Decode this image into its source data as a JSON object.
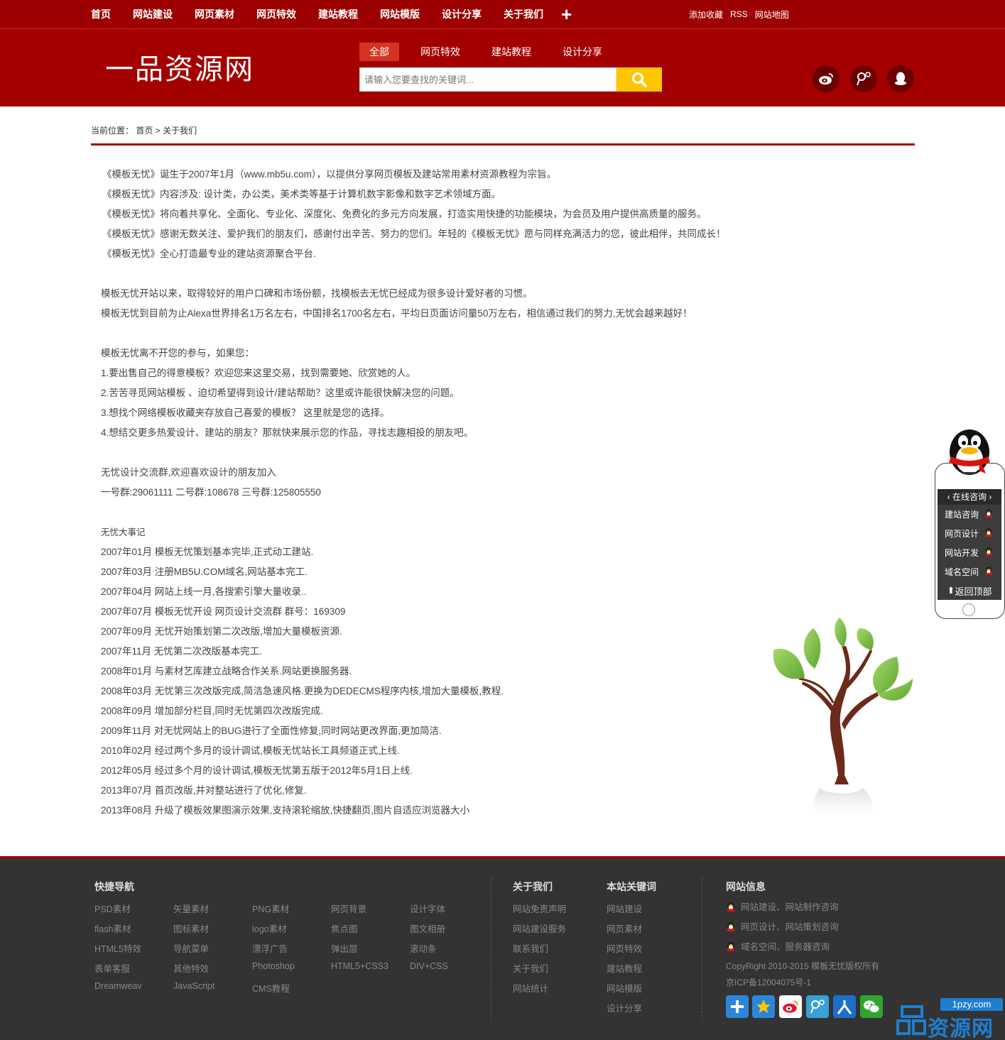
{
  "topnav": {
    "items": [
      "首页",
      "网站建设",
      "网页素材",
      "网页特效",
      "建站教程",
      "网站模版",
      "设计分享",
      "关于我们"
    ],
    "plus": "+",
    "right": [
      "添加收藏",
      "RSS",
      "网站地图"
    ]
  },
  "header": {
    "logo": "一品资源网",
    "search_tabs": [
      "全部",
      "网页特效",
      "建站教程",
      "设计分享"
    ],
    "active_tab": "全部",
    "search_placeholder": "请输入您要查找的关键词...",
    "social_icons": [
      "weibo-icon",
      "tencent-weibo-icon",
      "qq-icon"
    ]
  },
  "breadcrumb": {
    "prefix": "当前位置：",
    "home": "首页",
    "sep": ">",
    "current": "关于我们"
  },
  "content": {
    "intro": [
      "《模板无忧》诞生于2007年1月（www.mb5u.com），以提供分享网页模板及建站常用素材资源教程为宗旨。",
      "《模板无忧》内容涉及: 设计类，办公类，美术类等基于计算机数字影像和数字艺术领域方面。",
      "《模板无忧》将向着共享化、全面化、专业化、深度化、免费化的多元方向发展，打造实用快捷的功能模块，为会员及用户提供高质量的服务。",
      "《模板无忧》感谢无数关注、爱护我们的朋友们，感谢付出辛苦、努力的您们。年轻的《模板无忧》愿与同样充满活力的您，彼此相伴，共同成长！",
      "《模板无忧》全心打造最专业的建站资源聚合平台."
    ],
    "stats": [
      "模板无忧开站以来，取得较好的用户口碑和市场份额，找模板去无忧已经成为很多设计爱好者的习惯。",
      "模板无忧到目前为止Alexa世界排名1万名左右，中国排名1700名左右，平均日页面访问量50万左右，相信通过我们的努力,无忧会越来越好！"
    ],
    "join": [
      "模板无忧离不开您的参与，如果您：",
      "1.要出售自己的得意模板？欢迎您来这里交易，找到需要她、欣赏她的人。",
      "2.苦苦寻觅网站模板 、迫切希望得到设计/建站帮助？这里或许能很快解决您的问题。",
      "3.想找个网络模板收藏夹存放自己喜爱的模板？ 这里就是您的选择。",
      "4.想结交更多热爱设计、建站的朋友？那就快来展示您的作品，寻找志趣相投的朋友吧。"
    ],
    "groups": [
      "无忧设计交流群,欢迎喜欢设计的朋友加入",
      "一号群:29061111 二号群:108678 三号群:125805550"
    ],
    "history_title": "无忧大事记",
    "history": [
      "2007年01月 模板无忧策划基本完毕,正式动工建站.",
      "2007年03月 注册MB5U.COM域名,网站基本完工.",
      "2007年04月 网站上线一月,各搜索引擎大量收录..",
      "2007年07月 模板无忧开设 网页设计交流群 群号：169309",
      "2007年09月 无忧开始策划第二次改版,增加大量模板资源.",
      "2007年11月 无忧第二次改版基本完工.",
      "2008年01月 与素材艺库建立战略合作关系.网站更换服务器.",
      "2008年03月 无忧第三次改版完成,简洁急速风格.更换为DEDECMS程序内核,增加大量模板,教程.",
      "2008年09月 增加部分栏目,同时无忧第四次改版完成.",
      "2009年11月 对无忧网站上的BUG进行了全面性修复,同时网站更改界面,更加简洁.",
      "2010年02月 经过两个多月的设计调试,模板无忧站长工具频道正式上线.",
      "2012年05月 经过多个月的设计调试,模板无忧第五版于2012年5月1日上线.",
      "2013年07月 首页改版,并对整站进行了优化,修复.",
      "2013年08月 升级了模板效果图演示效果,支持滚轮缩放,快捷翻页,图片自适应浏览器大小"
    ]
  },
  "side_widget": {
    "title": "在线咨询",
    "items": [
      "建站咨询",
      "网页设计",
      "网站开发",
      "域名空间"
    ],
    "back_top": "返回顶部"
  },
  "footer": {
    "quick_nav_title": "快捷导航",
    "quick_nav_cols": [
      [
        "PSD素材",
        "flash素材",
        "HTML5特效",
        "表单客服",
        "Dreamweav"
      ],
      [
        "矢量素材",
        "图标素材",
        "导航菜单",
        "其他特效",
        "JavaScript"
      ],
      [
        "PNG素材",
        "logo素材",
        "漂浮广告",
        "Photoshop",
        "CMS教程"
      ],
      [
        "网页背景",
        "焦点图",
        "弹出层",
        "HTML5+CSS3"
      ],
      [
        "设计字体",
        "图文相册",
        "滚动条",
        "DIV+CSS"
      ]
    ],
    "about_title": "关于我们",
    "about_links": [
      "网站免责声明",
      "网站建设服务",
      "联系我们",
      "关于我们",
      "网站统计"
    ],
    "keywords_title": "本站关键词",
    "keywords_links": [
      "网站建设",
      "网页素材",
      "网页特效",
      "建站教程",
      "网站模版",
      "设计分享"
    ],
    "info_title": "网站信息",
    "info_items": [
      "网站建设、网站制作咨询",
      "网页设计、网站策划咨询",
      "域名空间、服务器咨询"
    ],
    "copyright": "CopyRight 2010-2015 模板无忧版权所有",
    "icp": "京ICP备12004075号-1",
    "share_icons": [
      "add-icon",
      "star-icon",
      "sina-weibo-icon",
      "tencent-weibo-icon",
      "renren-icon",
      "wechat-icon"
    ]
  },
  "watermark": {
    "badge": "1pzy.com",
    "text": "资源网"
  },
  "colors": {
    "primary": "#a40000",
    "topbar": "#9c0000",
    "active_tab": "#d4341f",
    "search_button": "#ffc600",
    "footer_bg": "#333333",
    "watermark": "#1e7fd0"
  }
}
